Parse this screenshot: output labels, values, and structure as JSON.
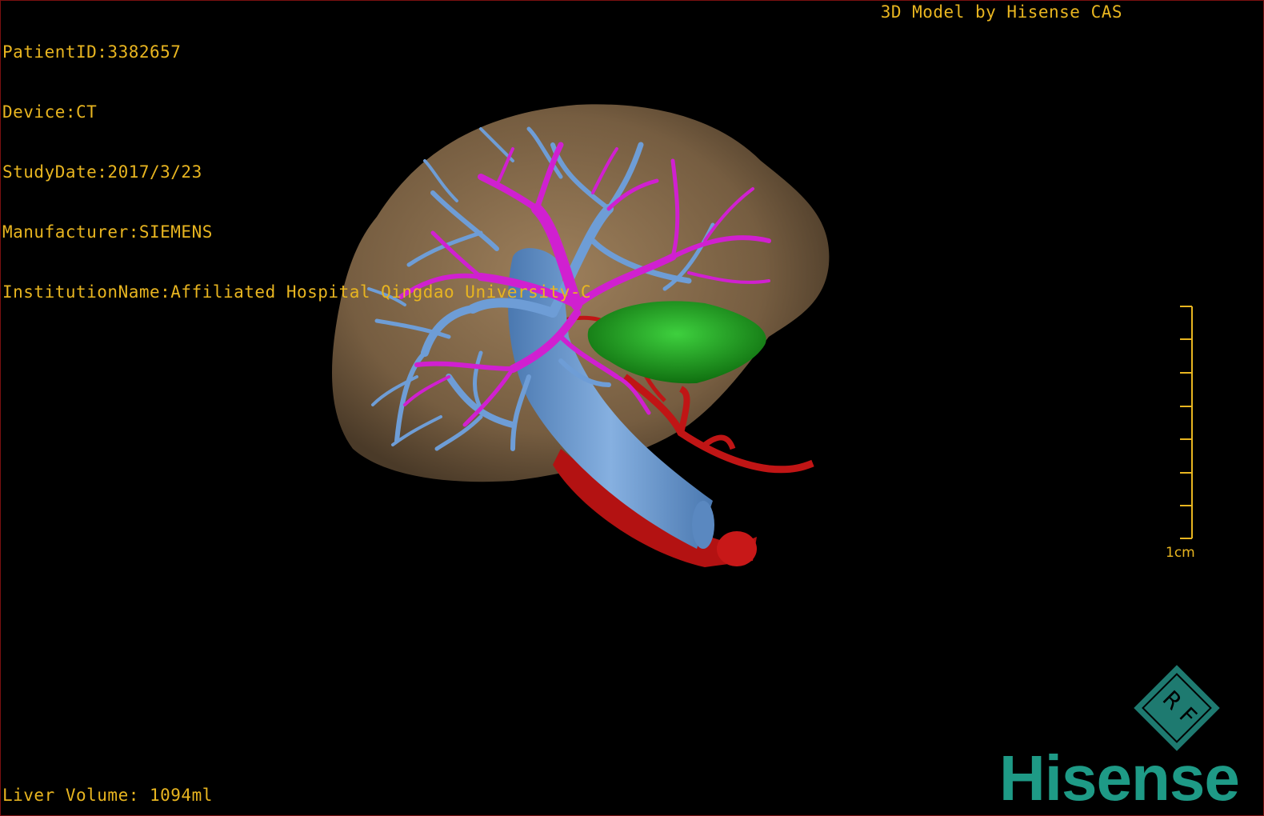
{
  "header": {
    "patient_id": "PatientID:3382657",
    "device": "Device:CT",
    "study_date": "StudyDate:2017/3/23",
    "manufacturer": "Manufacturer:SIEMENS",
    "institution": "InstitutionName:Affiliated Hospital Qingdao University-C"
  },
  "title": "3D Model by Hisense CAS",
  "footer": {
    "liver_volume": "Liver Volume: 1094ml"
  },
  "scale_bar": {
    "label": "1cm"
  },
  "logo": {
    "text": "Hisense",
    "mark": "RF"
  },
  "colors": {
    "overlay_text": "#e8b520",
    "liver": "#8a6f4e",
    "portal_vein": "#6e9dd6",
    "hepatic_vein": "#d020d0",
    "artery": "#c01515",
    "gallbladder": "#20a020",
    "logo": "#1e9a86"
  },
  "model": {
    "structures": [
      "liver",
      "inferior-vena-cava",
      "portal-vein",
      "hepatic-veins",
      "hepatic-artery",
      "aorta",
      "gallbladder"
    ]
  }
}
